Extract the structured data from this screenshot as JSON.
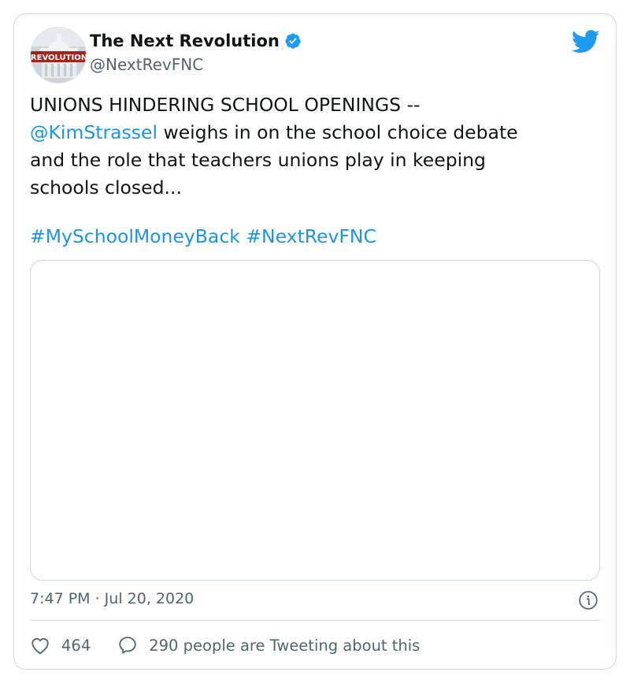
{
  "author": {
    "name": "The Next Revolution",
    "handle": "@NextRevFNC",
    "avatar_text": "REVOLUTION",
    "verified": true
  },
  "tweet": {
    "line1": "UNIONS HINDERING SCHOOL OPENINGS --",
    "mention": "@KimStrassel",
    "line2_rest": " weighs in on the school choice debate",
    "line3": "and the role that teachers unions play in keeping",
    "line4": "schools closed...",
    "hashtag1": "#MySchoolMoneyBack",
    "hashtag2": "#NextRevFNC"
  },
  "timestamp": "7:47 PM · Jul 20, 2020",
  "stats": {
    "likes": "464",
    "conversation": "290 people are Tweeting about this"
  },
  "icons": {
    "verified": "verified-badge-icon",
    "logo": "twitter-bird-icon",
    "info": "info-icon",
    "like": "heart-icon",
    "reply": "speech-bubble-icon"
  },
  "colors": {
    "link": "#1b95e0",
    "secondary_text": "#536471",
    "border": "#cfd9de",
    "twitter_blue": "#1d9bf0"
  }
}
